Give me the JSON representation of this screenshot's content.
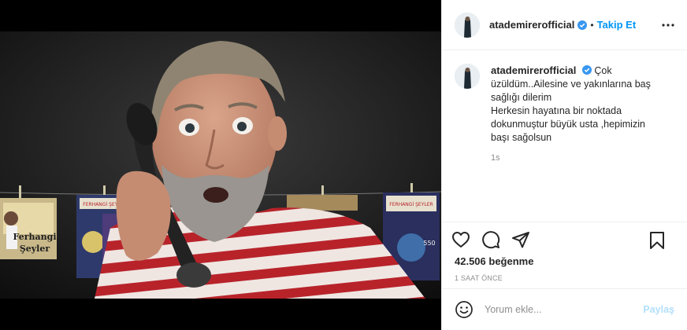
{
  "post": {
    "username": "atademirerofficial",
    "follow_label": "Takip Et",
    "dot": "•",
    "caption_lines": [
      "Çok",
      "üzüldüm..Ailesine ve yakınlarına baş",
      "sağlığı dilerim",
      "Herkesin hayatına bir noktada",
      "dokunmuştur büyük usta ,hepimizin",
      "başı sağolsun"
    ],
    "caption_time": "1s",
    "likes": "42.506 beğenme",
    "time_ago": "1 SAAT ÖNCE",
    "comment_placeholder": "Yorum ekle...",
    "post_label": "Paylaş"
  },
  "photo": {
    "poster_left_title_1": "Ferhangi",
    "poster_left_title_2": "Şeyler",
    "poster_mid": "FERHANGİ ŞEYLER",
    "poster_right": "FERHANGİ ŞEYLER",
    "poster_right_num": "550"
  },
  "colors": {
    "accent": "#0095f6",
    "post_disabled": "#b2dffc",
    "stripe_red": "#b8232a"
  },
  "icons": {
    "like": "heart-icon",
    "comment": "comment-icon",
    "share": "share-icon",
    "save": "bookmark-icon",
    "more": "more-options-icon",
    "emoji": "emoji-icon",
    "verified": "verified-badge-icon"
  }
}
